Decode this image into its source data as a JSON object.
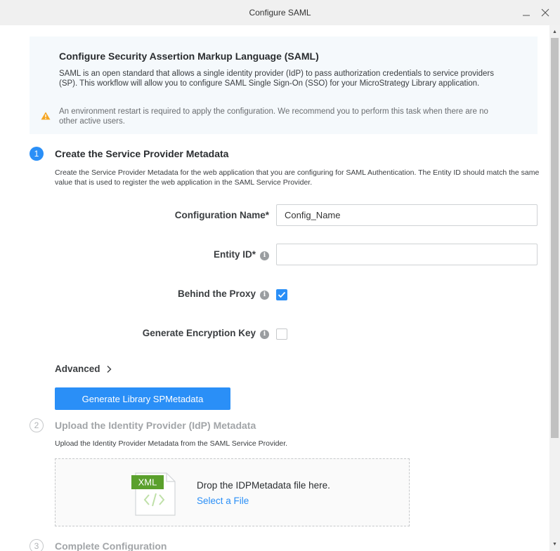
{
  "window": {
    "title": "Configure SAML",
    "minimize_icon": "minimize-icon",
    "close_icon": "close-icon"
  },
  "banner": {
    "title": "Configure Security Assertion Markup Language (SAML)",
    "description": "SAML is an open standard that allows a single identity provider (IdP) to pass authorization credentials to service providers (SP). This workflow will allow you to configure SAML Single Sign-On (SSO) for your MicroStrategy Library application.",
    "warning_icon": "warning-icon",
    "warning_color": "#f5a623",
    "warning": "An environment restart is required to apply the configuration. We recommend you to perform this task when there are no other active users."
  },
  "steps": [
    {
      "number": "1",
      "title": "Create the Service Provider Metadata",
      "description": "Create the Service Provider Metadata for the web application that you are configuring for SAML Authentication. The Entity ID should match the same value that is used to register the web application in the SAML Service Provider.",
      "state": "active"
    },
    {
      "number": "2",
      "title": "Upload the Identity Provider (IdP) Metadata",
      "description": "Upload the Identity Provider Metadata from the SAML Service Provider.",
      "state": "inactive"
    },
    {
      "number": "3",
      "title": "Complete Configuration",
      "state": "inactive"
    }
  ],
  "form": {
    "config_name_label": "Configuration Name*",
    "config_name_value": "Config_Name",
    "entity_id_label": "Entity ID*",
    "entity_id_value": "",
    "behind_proxy_label": "Behind the Proxy",
    "behind_proxy_checked": true,
    "encryption_key_label": "Generate Encryption Key",
    "encryption_key_checked": false,
    "info_icon": "info-icon",
    "info_glyph": "i"
  },
  "advanced_label": "Advanced",
  "generate_button_label": "Generate Library SPMetadata",
  "upload": {
    "file_badge": "XML",
    "file_icon": "xml-file-icon",
    "drop_text": "Drop the IDPMetadata file here.",
    "select_link": "Select a File"
  },
  "colors": {
    "accent": "#2a8ff7",
    "xml_badge": "#5aa02c"
  }
}
